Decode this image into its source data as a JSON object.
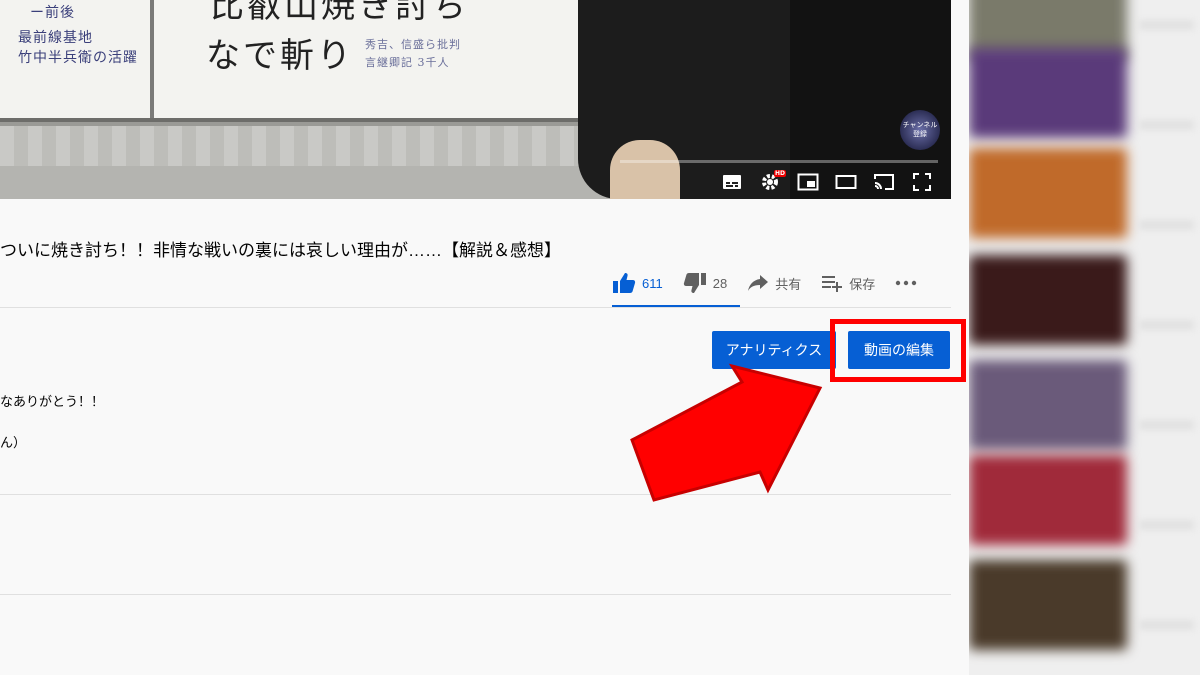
{
  "player": {
    "board_lines": {
      "left_top": "ー前後",
      "left_1": "最前線基地",
      "left_2": "竹中半兵衛の活躍",
      "big_top": "比叡山焼き討ち",
      "big_bottom": "なで斬り",
      "note_1": "秀吉、信盛ら批判",
      "note_2": "言継卿記 3千人"
    },
    "watermark": "チャンネル登録",
    "hd_badge": "HD"
  },
  "video": {
    "title": "ついに焼き討ち！！非情な戦いの裏には哀しい理由が……【解説＆感想】"
  },
  "actions": {
    "like_count": "611",
    "dislike_count": "28",
    "share_label": "共有",
    "save_label": "保存",
    "accent": "#065fd4"
  },
  "buttons": {
    "analytics_label": "アナリティクス",
    "edit_label": "動画の編集"
  },
  "description": {
    "line1": "なありがとう！！",
    "line2": "ん）"
  },
  "annotation": {
    "highlight_color": "#ff0000"
  }
}
